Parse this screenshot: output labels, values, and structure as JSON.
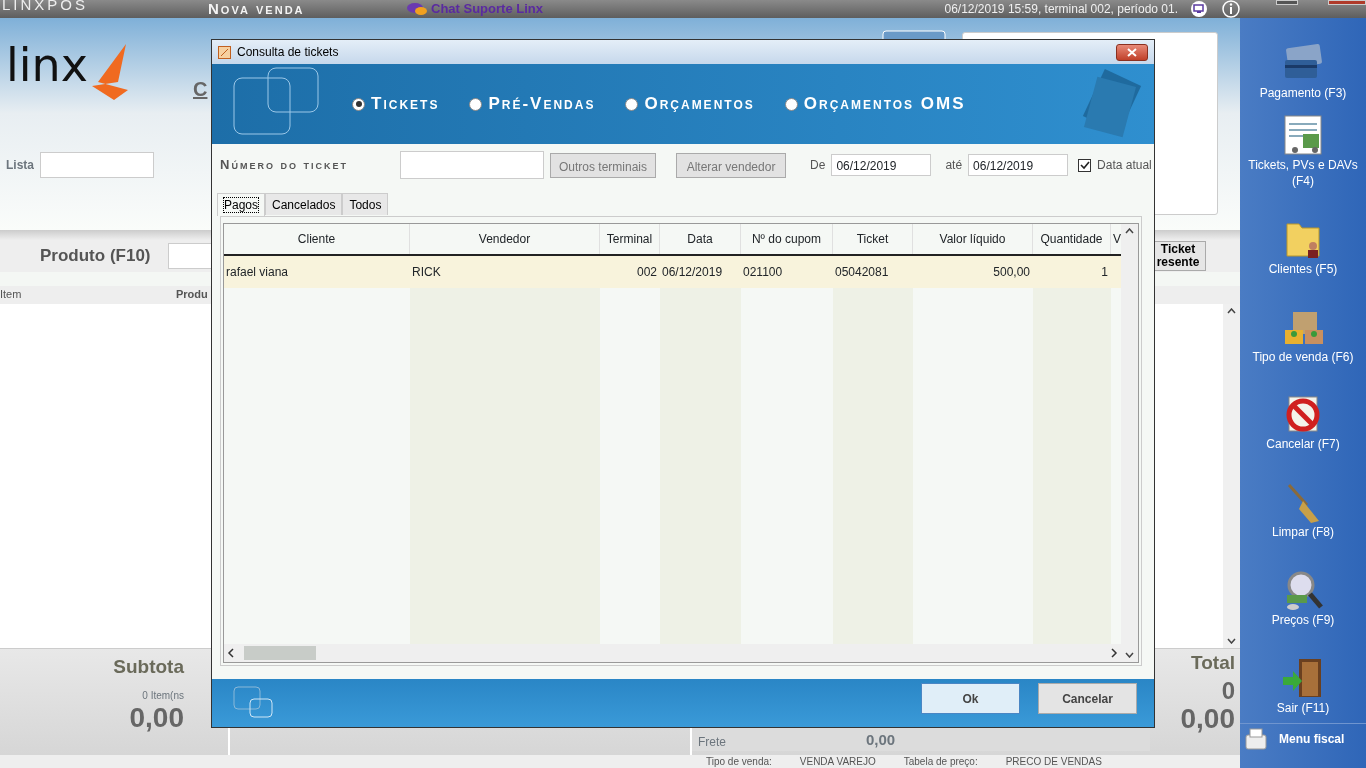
{
  "top_bar": {
    "app_title": "LINXPOS",
    "screen_title": "Nova venda",
    "chat_link": "Chat Suporte Linx",
    "session_info": "06/12/2019 15:59, terminal 002, período 01."
  },
  "sale_screen": {
    "logo_text": "linx",
    "heading": "C",
    "lista_label": "Lista",
    "produto_label": "Produto (F10)",
    "ticket_presente_button": "Ticket resente",
    "columns": [
      "Item",
      "Produ"
    ],
    "totals": {
      "subtotal_label": "Subtota",
      "items_count": "0 Item(ns",
      "subtotal_value": "0,00",
      "frete_label": "Frete",
      "frete_value": "0,00",
      "total_label": "Total",
      "total_quantity": "0",
      "total_value": "0,00"
    },
    "status_bar": [
      {
        "label": "Tipo de venda:",
        "value": "VENDA VAREJO"
      },
      {
        "label": "Tabela de preço:",
        "value": "PRECO DE VENDAS"
      }
    ]
  },
  "sidebar": {
    "items": [
      {
        "label": "Pagamento (F3)",
        "kind": "payment"
      },
      {
        "label": "Tickets, PVs e DAVs (F4)",
        "kind": "tickets"
      },
      {
        "label": "Clientes (F5)",
        "kind": "clients"
      },
      {
        "label": "Tipo de venda (F6)",
        "kind": "sale_type"
      },
      {
        "label": "Cancelar (F7)",
        "kind": "cancel"
      },
      {
        "label": "Limpar (F8)",
        "kind": "clear"
      },
      {
        "label": "Preços (F9)",
        "kind": "prices"
      },
      {
        "label": "Sair (F11)",
        "kind": "exit"
      }
    ],
    "menu_fiscal": "Menu fiscal"
  },
  "dialog": {
    "title": "Consulta de tickets",
    "modes": [
      {
        "label": "Tickets",
        "selected": true
      },
      {
        "label": "Pré-Vendas",
        "selected": false
      },
      {
        "label": "Orçamentos",
        "selected": false
      },
      {
        "label": "Orçamentos OMS",
        "selected": false
      }
    ],
    "ticket_number_label": "Número do ticket",
    "filter_buttons": [
      "Outros terminais",
      "Alterar vendedor"
    ],
    "date_from": {
      "label": "De",
      "value": "06/12/2019"
    },
    "date_to": {
      "label": "até",
      "value": "06/12/2019"
    },
    "data_atual": {
      "label": "Data atual",
      "checked": true
    },
    "tabs": [
      {
        "label": "Pagos",
        "selected": true
      },
      {
        "label": "Cancelados",
        "selected": false
      },
      {
        "label": "Todos",
        "selected": false
      }
    ],
    "table": {
      "columns": [
        "Cliente",
        "Vendedor",
        "Terminal",
        "Data",
        "Nº do cupom",
        "Ticket",
        "Valor líquido",
        "Quantidade",
        "V"
      ],
      "rows": [
        {
          "selected": true,
          "cells": [
            "rafael viana",
            "RICK",
            "002",
            "06/12/2019",
            "021100",
            "05042081",
            "500,00",
            "1"
          ]
        }
      ]
    },
    "buttons": [
      {
        "label": "Ok",
        "kind": "primary"
      },
      {
        "label": "Cancelar",
        "kind": "secondary"
      }
    ]
  }
}
